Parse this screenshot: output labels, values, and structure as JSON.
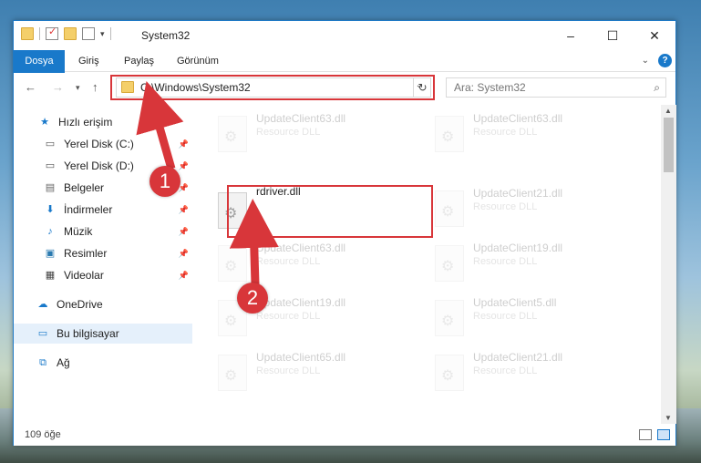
{
  "window": {
    "title": "System32",
    "controls": {
      "minimize": "–",
      "maximize": "☐",
      "close": "✕"
    }
  },
  "ribbon": {
    "tabs": [
      "Dosya",
      "Giriş",
      "Paylaş",
      "Görünüm"
    ],
    "help": "?"
  },
  "address": {
    "path": "C:\\Windows\\System32",
    "search_placeholder": "Ara: System32"
  },
  "sidebar": {
    "items": [
      {
        "label": "Hızlı erişim",
        "icon": "star-icon",
        "pinned": false
      },
      {
        "label": "Yerel Disk (C:)",
        "icon": "drive-icon",
        "pinned": true
      },
      {
        "label": "Yerel Disk (D:)",
        "icon": "drive-icon",
        "pinned": true
      },
      {
        "label": "Belgeler",
        "icon": "documents-icon",
        "pinned": true
      },
      {
        "label": "İndirmeler",
        "icon": "download-icon",
        "pinned": true
      },
      {
        "label": "Müzik",
        "icon": "music-icon",
        "pinned": true
      },
      {
        "label": "Resimler",
        "icon": "pictures-icon",
        "pinned": true
      },
      {
        "label": "Videolar",
        "icon": "video-icon",
        "pinned": true
      },
      {
        "label": "OneDrive",
        "icon": "cloud-icon",
        "pinned": false
      },
      {
        "label": "Bu bilgisayar",
        "icon": "computer-icon",
        "pinned": false
      },
      {
        "label": "Ağ",
        "icon": "network-icon",
        "pinned": false
      }
    ]
  },
  "files": {
    "highlighted": {
      "name": "rdriver.dll"
    },
    "left_column": [
      {
        "name": "UpdateClient63.dll",
        "type": "Resource DLL"
      },
      {
        "name": "UpdateClient63.dll",
        "type": "Resource DLL"
      },
      {
        "name": "UpdateClient19.dll",
        "type": "Resource DLL"
      },
      {
        "name": "UpdateClient65.dll",
        "type": "Resource DLL"
      }
    ],
    "right_column": [
      {
        "name": "UpdateClient63.dll",
        "type": "Resource DLL"
      },
      {
        "name": "UpdateClient21.dll",
        "type": "Resource DLL"
      },
      {
        "name": "UpdateClient19.dll",
        "type": "Resource DLL"
      },
      {
        "name": "UpdateClient5.dll",
        "type": "Resource DLL"
      },
      {
        "name": "UpdateClient21.dll",
        "type": "Resource DLL"
      }
    ]
  },
  "status": {
    "item_count": "109 öğe"
  },
  "annotations": {
    "step1": "1",
    "step2": "2"
  },
  "colors": {
    "accent": "#1979ca",
    "highlight": "#d8363a"
  }
}
